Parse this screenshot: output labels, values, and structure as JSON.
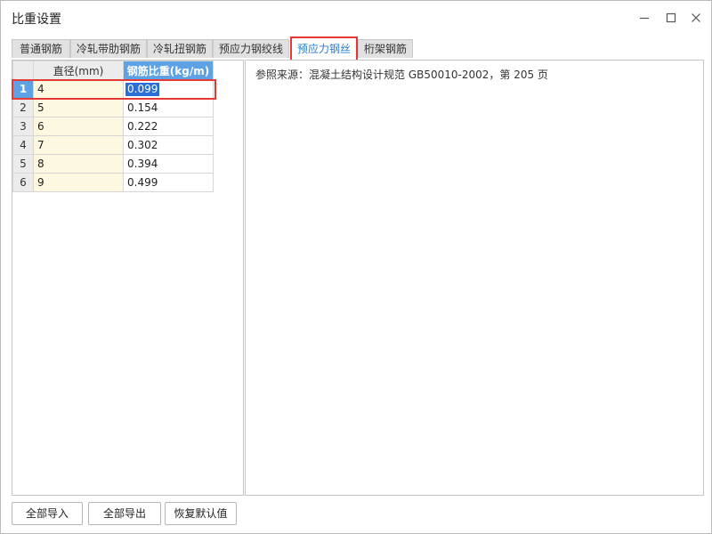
{
  "window": {
    "title": "比重设置"
  },
  "tabs": [
    {
      "label": "普通钢筋"
    },
    {
      "label": "冷轧带肋钢筋"
    },
    {
      "label": "冷轧扭钢筋"
    },
    {
      "label": "预应力钢绞线"
    },
    {
      "label": "预应力钢丝"
    },
    {
      "label": "桁架钢筋"
    }
  ],
  "active_tab": "预应力钢丝",
  "table": {
    "columns": [
      "直径(mm)",
      "钢筋比重(kg/m)"
    ],
    "rows": [
      {
        "num": "1",
        "diameter": "4",
        "weight": "0.099"
      },
      {
        "num": "2",
        "diameter": "5",
        "weight": "0.154"
      },
      {
        "num": "3",
        "diameter": "6",
        "weight": "0.222"
      },
      {
        "num": "4",
        "diameter": "7",
        "weight": "0.302"
      },
      {
        "num": "5",
        "diameter": "8",
        "weight": "0.394"
      },
      {
        "num": "6",
        "diameter": "9",
        "weight": "0.499"
      }
    ],
    "selected_row": "1"
  },
  "source": "参照来源：混凝土结构设计规范 GB50010-2002，第 205 页",
  "buttons": {
    "import_all": "全部导入",
    "export_all": "全部导出",
    "restore_default": "恢复默认值"
  },
  "icons": {
    "minimize": "minimize-icon",
    "maximize": "maximize-icon",
    "close": "close-icon"
  },
  "colors": {
    "accent": "#2a7ed0",
    "highlight_header": "#5ea2e6",
    "annotation": "#e53935",
    "diameter_cell": "#fdf9e1"
  }
}
